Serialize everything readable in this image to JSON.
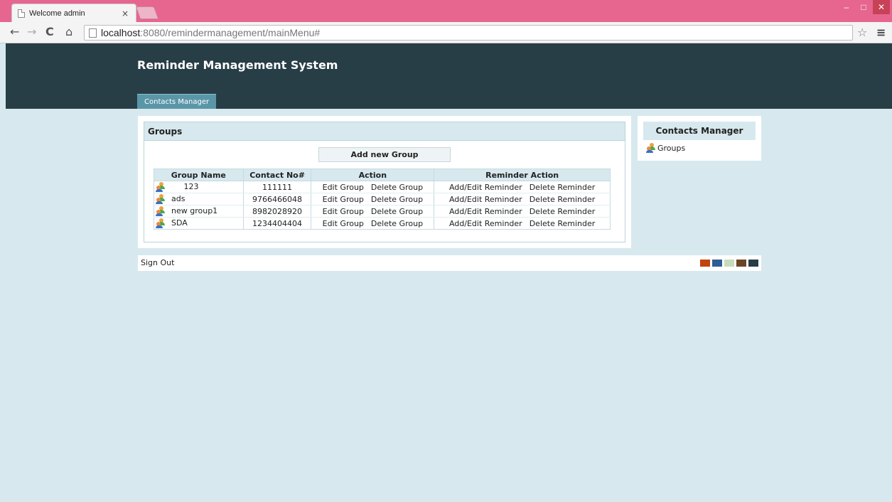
{
  "browser": {
    "tab_title": "Welcome admin",
    "tab_close": "×",
    "url_host": "localhost",
    "url_rest": ":8080/remindermanagement/mainMenu#",
    "win_min": "–",
    "win_max": "□",
    "win_close": "✕",
    "back": "←",
    "forward": "→",
    "reload": "C",
    "home": "⌂",
    "star": "☆",
    "menu": "≡"
  },
  "header": {
    "title": "Reminder Management System",
    "tab": "Contacts Manager"
  },
  "groups": {
    "heading": "Groups",
    "add_button": "Add new Group",
    "columns": [
      "Group Name",
      "Contact No#",
      "Action",
      "Reminder Action"
    ],
    "edit_label": "Edit Group",
    "delete_label": "Delete Group",
    "add_edit_reminder_label": "Add/Edit Reminder",
    "delete_reminder_label": "Delete Reminder",
    "rows": [
      {
        "name": "123",
        "contact": "111111"
      },
      {
        "name": "ads",
        "contact": "9766466048"
      },
      {
        "name": "new group1",
        "contact": "8982028920"
      },
      {
        "name": "SDA",
        "contact": "1234404404"
      }
    ]
  },
  "sidebar": {
    "heading": "Contacts Manager",
    "item": "Groups"
  },
  "footer": {
    "sign_out": "Sign Out",
    "swatches": [
      "#c1440e",
      "#2f5d95",
      "#c7dcbb",
      "#6b4426",
      "#283e46"
    ]
  }
}
